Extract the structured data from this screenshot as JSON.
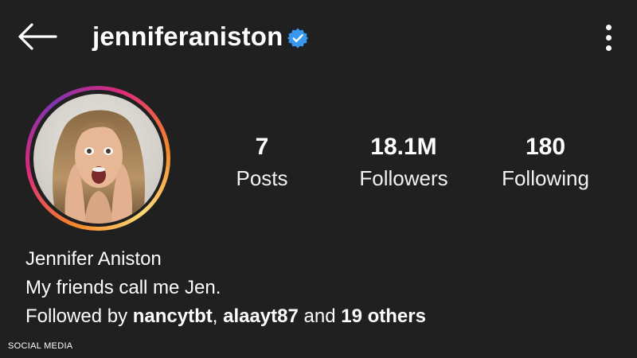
{
  "header": {
    "back_icon": "arrow-left-icon",
    "username": "jenniferaniston",
    "verified_icon": "verified-badge-icon",
    "verified_color": "#3897f0",
    "more_icon": "more-vertical-icon"
  },
  "profile": {
    "avatar_icon": "profile-photo",
    "ring_colors": [
      "#feda77",
      "#f58529",
      "#dd2a7b",
      "#8134af"
    ],
    "stats": {
      "posts": {
        "value": "7",
        "label": "Posts"
      },
      "followers": {
        "value": "18.1M",
        "label": "Followers"
      },
      "following": {
        "value": "180",
        "label": "Following"
      }
    }
  },
  "bio": {
    "full_name": "Jennifer Aniston",
    "text": "My friends call me Jen.",
    "followed_by_prefix": "Followed by",
    "follower_1": "nancytbt",
    "separator": ",",
    "follower_2": "alaayt87",
    "and_text": "and",
    "others": "19 others"
  },
  "watermark": "SOCIAL MEDIA",
  "colors": {
    "background": "#202020",
    "text": "#ffffff"
  }
}
